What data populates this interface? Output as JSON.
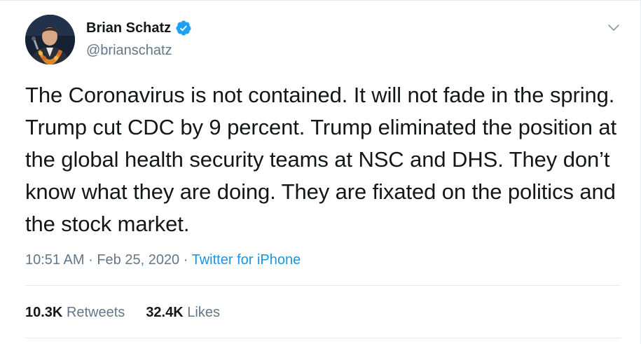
{
  "author": {
    "display_name": "Brian Schatz",
    "handle": "@brianschatz",
    "verified": true
  },
  "tweet": {
    "text": "The Coronavirus is not contained. It will not fade in the spring. Trump cut CDC by 9 percent. Trump eliminated the position at the global health security teams at NSC and DHS. They don’t know what they are doing. They are fixated on the politics and the stock market.",
    "time": "10:51 AM",
    "separator": "·",
    "date": "Feb 25, 2020",
    "source": "Twitter for iPhone"
  },
  "stats": {
    "retweets_count": "10.3K",
    "retweets_label": "Retweets",
    "likes_count": "32.4K",
    "likes_label": "Likes"
  },
  "colors": {
    "link": "#1b95e0",
    "secondary_text": "#657786",
    "primary_text": "#14171a",
    "verified_badge": "#1da1f2",
    "divider": "#e6ecf0"
  },
  "icons": {
    "verified": "verified-badge-icon",
    "more": "chevron-down-icon"
  }
}
